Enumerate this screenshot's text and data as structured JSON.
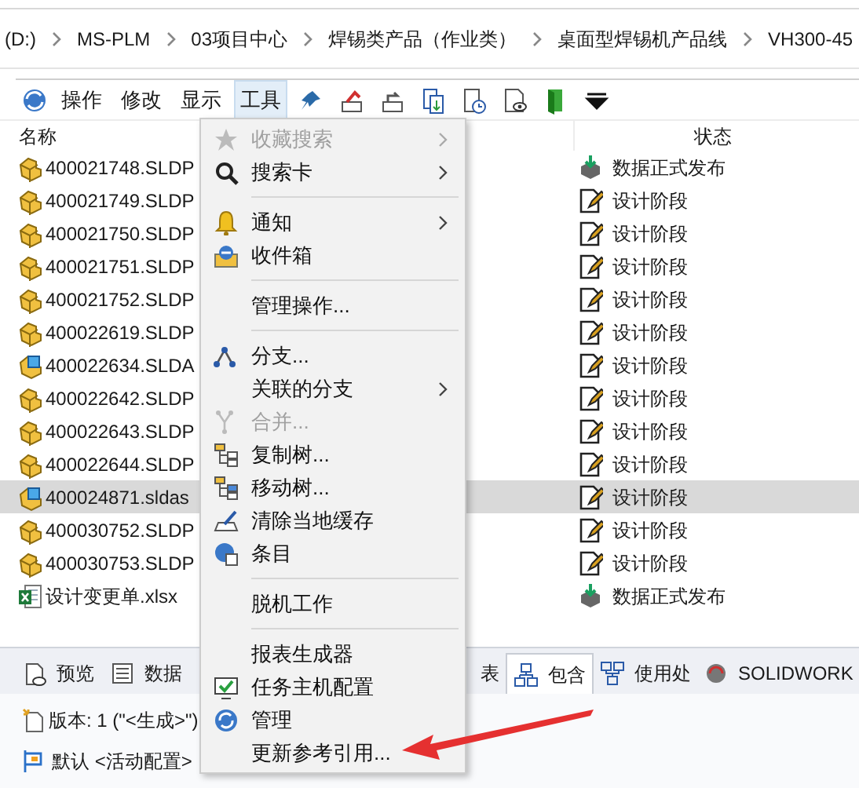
{
  "breadcrumb": [
    "(D:)",
    "MS-PLM",
    "03项目中心",
    "焊锡类产品（作业类）",
    "桌面型焊锡机产品线",
    "VH300-45"
  ],
  "menubar": [
    {
      "label": "操作",
      "selected": false
    },
    {
      "label": "修改",
      "selected": false
    },
    {
      "label": "显示",
      "selected": false
    },
    {
      "label": "工具",
      "selected": true
    }
  ],
  "columns": [
    "名称",
    "状态"
  ],
  "rows": [
    {
      "name": "400021748.SLDP",
      "kind": "part",
      "status": {
        "text": "数据正式发布",
        "kind": "released"
      },
      "selected": false
    },
    {
      "name": "400021749.SLDP",
      "kind": "part",
      "status": {
        "text": "设计阶段",
        "kind": "design"
      },
      "selected": false
    },
    {
      "name": "400021750.SLDP",
      "kind": "part",
      "status": {
        "text": "设计阶段",
        "kind": "design"
      },
      "selected": false
    },
    {
      "name": "400021751.SLDP",
      "kind": "part",
      "status": {
        "text": "设计阶段",
        "kind": "design"
      },
      "selected": false
    },
    {
      "name": "400021752.SLDP",
      "kind": "part",
      "status": {
        "text": "设计阶段",
        "kind": "design"
      },
      "selected": false
    },
    {
      "name": "400022619.SLDP",
      "kind": "part",
      "status": {
        "text": "设计阶段",
        "kind": "design"
      },
      "selected": false
    },
    {
      "name": "400022634.SLDA",
      "kind": "assembly",
      "status": {
        "text": "设计阶段",
        "kind": "design"
      },
      "selected": false
    },
    {
      "name": "400022642.SLDP",
      "kind": "part",
      "status": {
        "text": "设计阶段",
        "kind": "design"
      },
      "selected": false
    },
    {
      "name": "400022643.SLDP",
      "kind": "part",
      "status": {
        "text": "设计阶段",
        "kind": "design"
      },
      "selected": false
    },
    {
      "name": "400022644.SLDP",
      "kind": "part",
      "status": {
        "text": "设计阶段",
        "kind": "design"
      },
      "selected": false
    },
    {
      "name": "400024871.sldas",
      "kind": "assembly",
      "status": {
        "text": "设计阶段",
        "kind": "design"
      },
      "selected": true
    },
    {
      "name": "400030752.SLDP",
      "kind": "part",
      "status": {
        "text": "设计阶段",
        "kind": "design"
      },
      "selected": false
    },
    {
      "name": "400030753.SLDP",
      "kind": "part",
      "status": {
        "text": "设计阶段",
        "kind": "design"
      },
      "selected": false
    },
    {
      "name": "设计变更单.xlsx",
      "kind": "excel",
      "status": {
        "text": "数据正式发布",
        "kind": "released"
      },
      "selected": false
    }
  ],
  "bottom_tabs": [
    {
      "label": "预览",
      "selected": false
    },
    {
      "label": "数据",
      "selected": false
    },
    {
      "label": "表",
      "selected": false
    },
    {
      "label": "包含",
      "selected": true
    },
    {
      "label": "使用处",
      "selected": false
    },
    {
      "label": "SOLIDWORK",
      "selected": false
    }
  ],
  "version_line": "版本: 1 (\"<生成>\")",
  "config_line": "默认 <活动配置>",
  "menu": [
    {
      "kind": "item",
      "label": "收藏搜索",
      "disabled": true,
      "submenu": true
    },
    {
      "kind": "item",
      "label": "搜索卡",
      "disabled": false,
      "submenu": true
    },
    {
      "kind": "separator"
    },
    {
      "kind": "item",
      "label": "通知",
      "disabled": false,
      "submenu": true
    },
    {
      "kind": "item",
      "label": "收件箱",
      "disabled": false,
      "submenu": false
    },
    {
      "kind": "separator"
    },
    {
      "kind": "item",
      "label": "管理操作...",
      "disabled": false,
      "submenu": false
    },
    {
      "kind": "separator"
    },
    {
      "kind": "item",
      "label": "分支...",
      "disabled": false,
      "submenu": false
    },
    {
      "kind": "item",
      "label": "关联的分支",
      "disabled": false,
      "submenu": true
    },
    {
      "kind": "item",
      "label": "合并...",
      "disabled": true,
      "submenu": false
    },
    {
      "kind": "item",
      "label": "复制树...",
      "disabled": false,
      "submenu": false
    },
    {
      "kind": "item",
      "label": "移动树...",
      "disabled": false,
      "submenu": false
    },
    {
      "kind": "item",
      "label": "清除当地缓存",
      "disabled": false,
      "submenu": false
    },
    {
      "kind": "item",
      "label": "条目",
      "disabled": false,
      "submenu": false
    },
    {
      "kind": "separator"
    },
    {
      "kind": "item",
      "label": "脱机工作",
      "disabled": false,
      "submenu": false
    },
    {
      "kind": "separator"
    },
    {
      "kind": "item",
      "label": "报表生成器",
      "disabled": false,
      "submenu": false
    },
    {
      "kind": "item",
      "label": "任务主机配置",
      "disabled": false,
      "submenu": false
    },
    {
      "kind": "item",
      "label": "管理",
      "disabled": false,
      "submenu": false
    },
    {
      "kind": "item",
      "label": "更新参考引用...",
      "disabled": false,
      "submenu": false
    }
  ]
}
